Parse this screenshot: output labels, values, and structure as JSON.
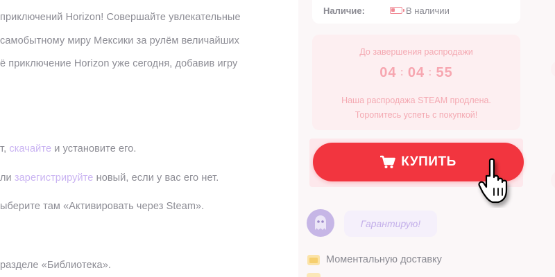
{
  "article": {
    "lines": [
      {
        "text": "приключений Horizon! Совершайте увлекательные"
      },
      {
        "text": "самобытному миру Мексики за рулём величайших"
      },
      {
        "text": "ё приключение Horizon уже сегодня, добавив игру"
      },
      {
        "before": "т, ",
        "link": "скачайте",
        "after": " и установите его."
      },
      {
        "before": "ли ",
        "link": "зарегистрируйте",
        "after": " новый, если у вас его нет."
      },
      {
        "text": "ыберите там «Активировать через Steam»."
      },
      {
        "text": "разделе «Библиотека»."
      }
    ]
  },
  "stock": {
    "label": "Наличие:",
    "value": "В наличии",
    "icon": "battery-icon"
  },
  "sale": {
    "title": "До завершения распродажи",
    "hours": "04",
    "minutes": "04",
    "seconds": "55",
    "separator": ":",
    "note_line1": "Наша распродажа STEAM продлена.",
    "note_line2": "Торопитесь успеть с покупкой!"
  },
  "buy_button": {
    "label": "КУПИТЬ",
    "icon": "cart-icon"
  },
  "guarantee": {
    "text": "Гарантирую!",
    "avatar_icon": "ghost-icon"
  },
  "features": [
    {
      "icon": "delivery-icon",
      "text": "Моментальную доставку"
    }
  ],
  "colors": {
    "accent": "#f2353f",
    "link": "#c9b3f2",
    "timer": "#f7a6b0",
    "sale_bg": "#fdeff1"
  }
}
